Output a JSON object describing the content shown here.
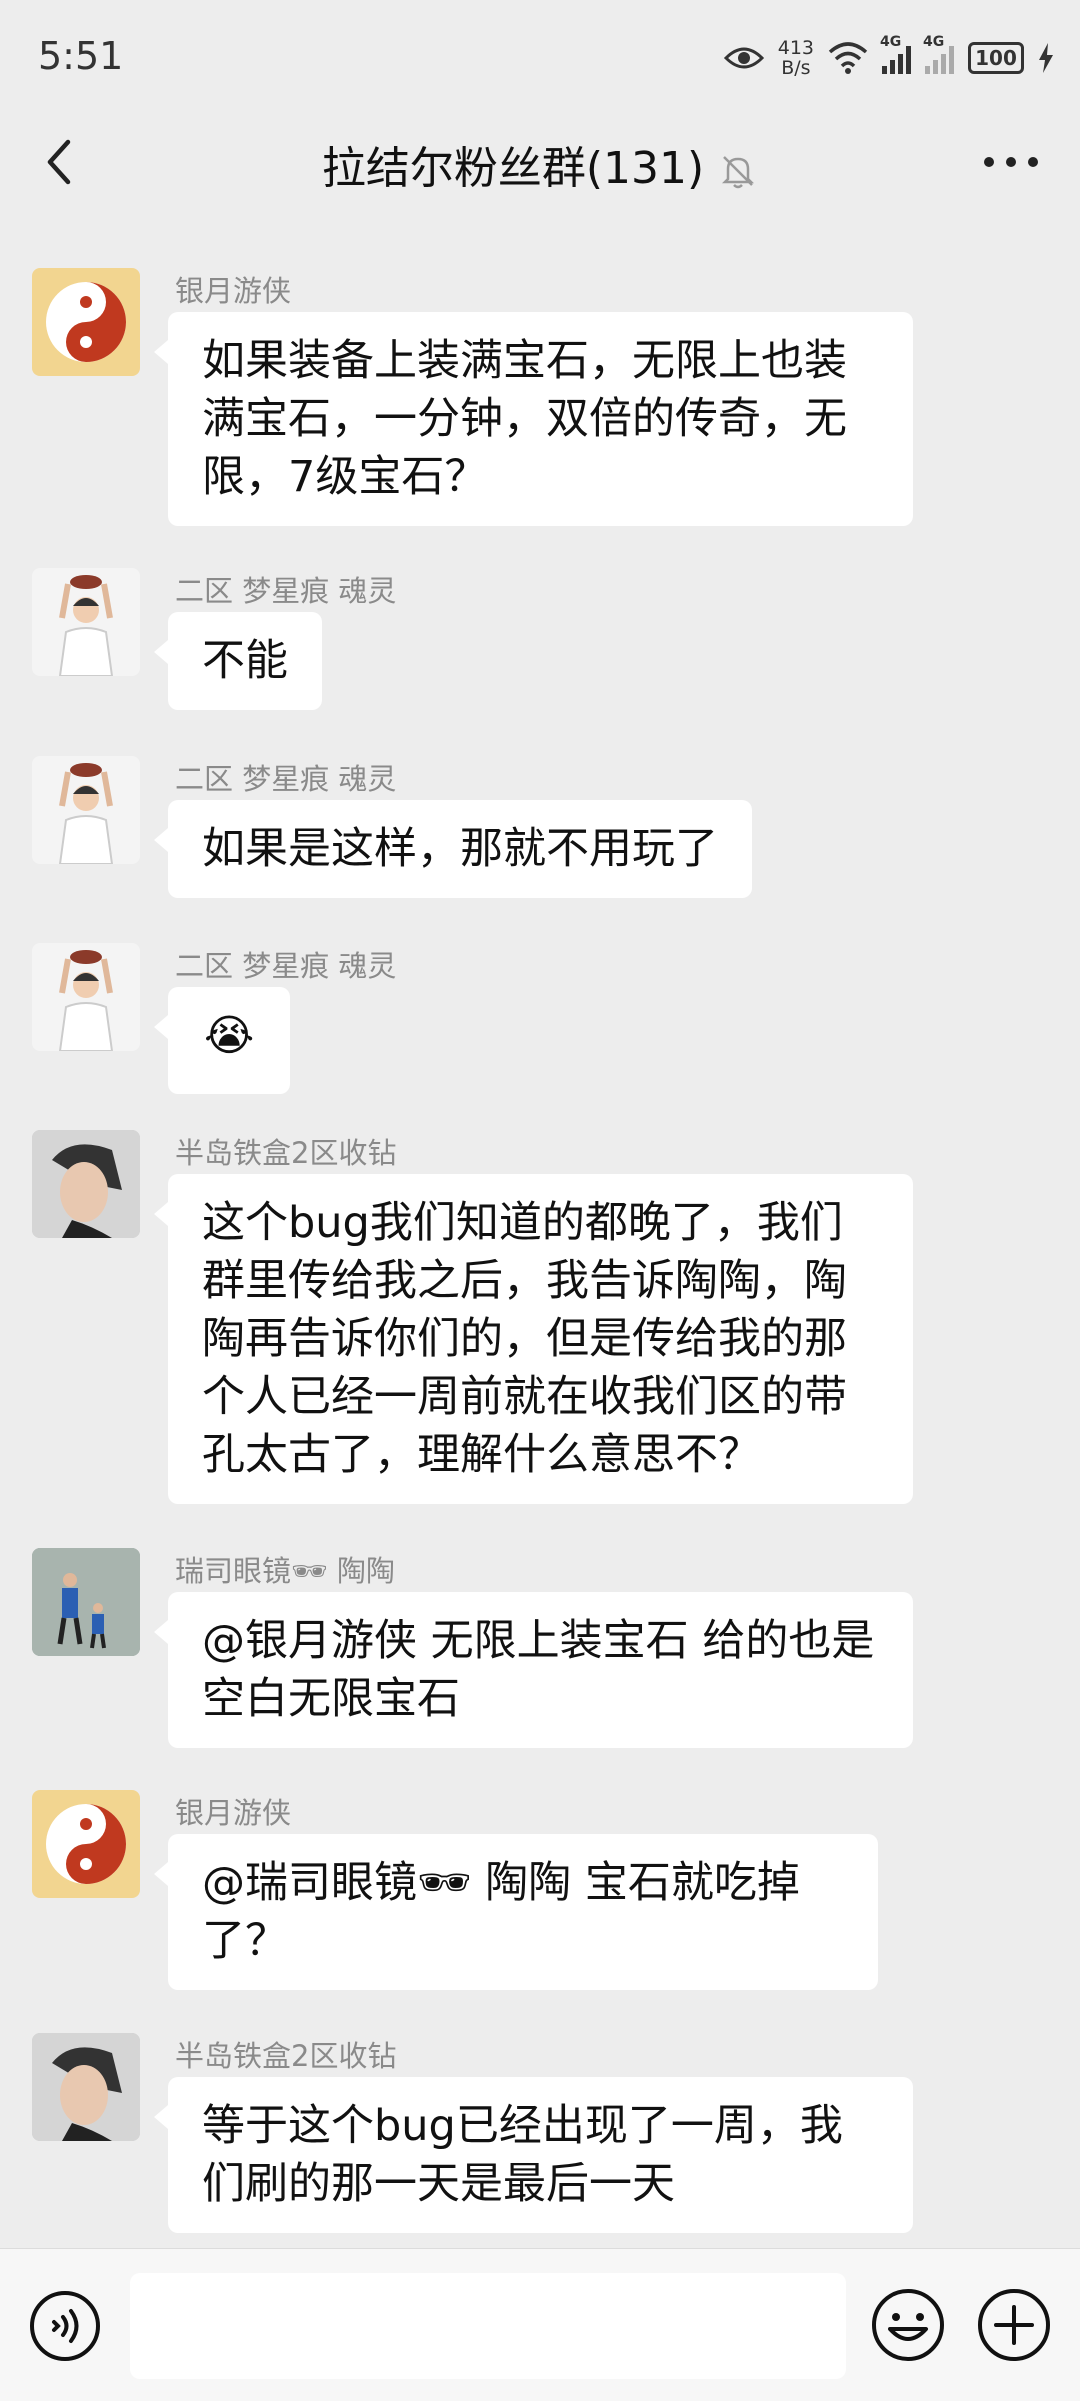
{
  "status": {
    "time": "5:51",
    "speed_value": "413",
    "speed_unit": "B/s",
    "net1": "4G",
    "net2": "4G",
    "battery": "100"
  },
  "header": {
    "title": "拉结尔粉丝群(131)"
  },
  "messages": [
    {
      "sender": "银月游侠",
      "text": "如果装备上装满宝石，无限上也装满宝石，一分钟，双倍的传奇，无限，7级宝石？",
      "avatar": "yin-yang-avatar"
    },
    {
      "sender": "二区 梦星痕 魂灵",
      "text": "不能",
      "avatar": "man-holding-bowl-avatar"
    },
    {
      "sender": "二区 梦星痕 魂灵",
      "text": "如果是这样，那就不用玩了",
      "avatar": "man-holding-bowl-avatar"
    },
    {
      "sender": "二区 梦星痕 魂灵",
      "text": "😭",
      "avatar": "man-holding-bowl-avatar"
    },
    {
      "sender": "半岛铁盒2区收钻",
      "text": "这个bug我们知道的都晚了，我们群里传给我之后，我告诉陶陶，陶陶再告诉你们的，但是传给我的那个人已经一周前就在收我们区的带孔太古了，理解什么意思不？",
      "avatar": "young-man-avatar"
    },
    {
      "sender": "瑞司眼镜🕶 陶陶",
      "text": "@银月游侠  无限上装宝石 给的也是空白无限宝石",
      "avatar": "parent-child-walking-avatar"
    },
    {
      "sender": "银月游侠",
      "text": "@瑞司眼镜🕶 陶陶  宝石就吃掉了？",
      "avatar": "yin-yang-avatar"
    },
    {
      "sender": "半岛铁盒2区收钻",
      "text": "等于这个bug已经出现了一周，我们刷的那一天是最后一天",
      "avatar": "young-man-avatar"
    }
  ],
  "input": {
    "placeholder": ""
  },
  "colors": {
    "background": "#ededed",
    "bubble": "#ffffff",
    "sender": "#8a8a8a"
  }
}
